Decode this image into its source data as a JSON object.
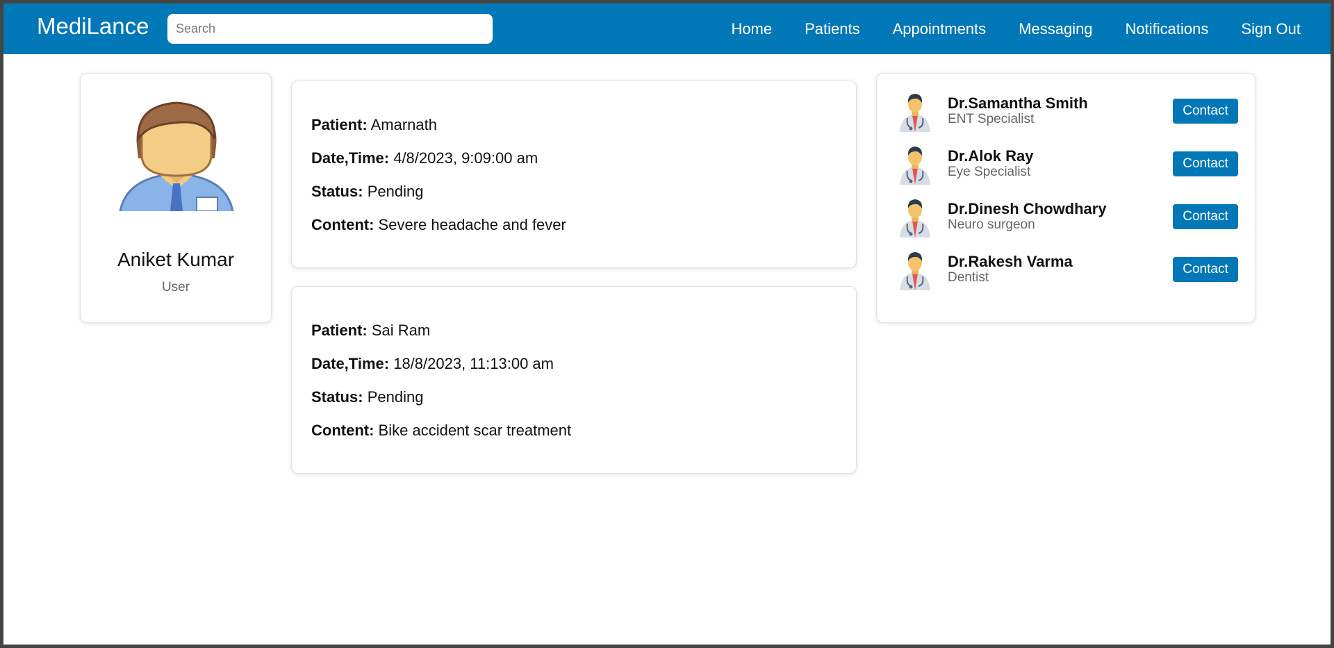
{
  "header": {
    "brand": "MediLance",
    "search_placeholder": "Search",
    "nav": [
      "Home",
      "Patients",
      "Appointments",
      "Messaging",
      "Notifications",
      "Sign Out"
    ]
  },
  "profile": {
    "name": "Aniket Kumar",
    "role": "User"
  },
  "labels": {
    "patient": "Patient:",
    "datetime": "Date,Time:",
    "status": "Status:",
    "content": "Content:"
  },
  "appointments": [
    {
      "patient": "Amarnath",
      "datetime": "4/8/2023, 9:09:00 am",
      "status": "Pending",
      "content": "Severe headache and fever"
    },
    {
      "patient": "Sai Ram",
      "datetime": "18/8/2023, 11:13:00 am",
      "status": "Pending",
      "content": "Bike accident scar treatment"
    }
  ],
  "doctors": [
    {
      "name": "Dr.Samantha Smith",
      "specialty": "ENT Specialist",
      "button": "Contact"
    },
    {
      "name": "Dr.Alok Ray",
      "specialty": "Eye Specialist",
      "button": "Contact"
    },
    {
      "name": "Dr.Dinesh Chowdhary",
      "specialty": "Neuro surgeon",
      "button": "Contact"
    },
    {
      "name": "Dr.Rakesh Varma",
      "specialty": "Dentist",
      "button": "Contact"
    }
  ],
  "colors": {
    "primary": "#0077b6",
    "border": "#444444"
  }
}
